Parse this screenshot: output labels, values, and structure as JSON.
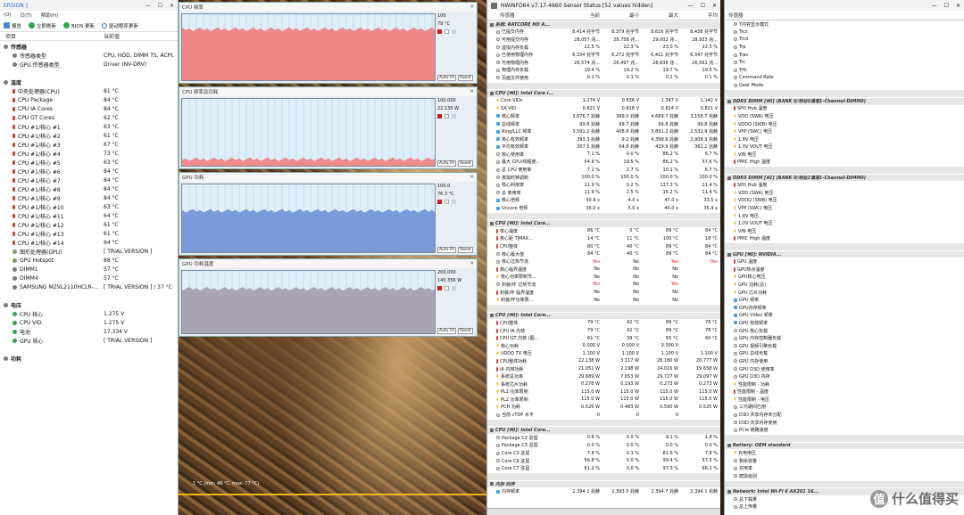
{
  "left": {
    "title": "ERSION ]",
    "menu": [
      "(O)",
      "日(T)",
      "帮助(H)"
    ],
    "toolbar": {
      "report": "报告",
      "refresh": "立即刷新",
      "bios": "BIOS 更新",
      "driver": "驱动程序更新"
    },
    "col_item": "项目",
    "col_value": "当前值",
    "rows": [
      {
        "g": true,
        "label": "传感器",
        "value": ""
      },
      {
        "i": 1,
        "icon": "dot",
        "label": "传感器类型",
        "value": "CPU, HDD, DIMM TS, ACPI, SNB"
      },
      {
        "i": 1,
        "icon": "dot",
        "label": "GPU 传感器类型",
        "value": "Driver (NV-DRV)"
      },
      {
        "g": false,
        "label": "",
        "value": ""
      },
      {
        "g": true,
        "label": "温度",
        "value": ""
      },
      {
        "i": 1,
        "icon": "temp",
        "label": "中央处理器(CPU)",
        "value": "81 °C"
      },
      {
        "i": 1,
        "icon": "temp",
        "label": "CPU Package",
        "value": "84 °C"
      },
      {
        "i": 1,
        "icon": "temp",
        "label": "CPU IA Cores",
        "value": "84 °C"
      },
      {
        "i": 1,
        "icon": "temp",
        "label": "CPU GT Cores",
        "value": "62 °C"
      },
      {
        "i": 1,
        "icon": "temp",
        "label": "CPU #1/核心 #1",
        "value": "63 °C"
      },
      {
        "i": 1,
        "icon": "temp",
        "label": "CPU #1/核心 #2",
        "value": "61 °C"
      },
      {
        "i": 1,
        "icon": "temp",
        "label": "CPU #1/核心 #3",
        "value": "67 °C"
      },
      {
        "i": 1,
        "icon": "temp",
        "label": "CPU #1/核心 #4",
        "value": "73 °C"
      },
      {
        "i": 1,
        "icon": "temp",
        "label": "CPU #1/核心 #5",
        "value": "63 °C"
      },
      {
        "i": 1,
        "icon": "temp",
        "label": "CPU #1/核心 #6",
        "value": "84 °C"
      },
      {
        "i": 1,
        "icon": "temp",
        "label": "CPU #1/核心 #7",
        "value": "84 °C"
      },
      {
        "i": 1,
        "icon": "temp",
        "label": "CPU #1/核心 #8",
        "value": "84 °C"
      },
      {
        "i": 1,
        "icon": "temp",
        "label": "CPU #1/核心 #9",
        "value": "84 °C"
      },
      {
        "i": 1,
        "icon": "temp",
        "label": "CPU #1/核心 #10",
        "value": "63 °C"
      },
      {
        "i": 1,
        "icon": "temp",
        "label": "CPU #1/核心 #11",
        "value": "64 °C"
      },
      {
        "i": 1,
        "icon": "temp",
        "label": "CPU #1/核心 #12",
        "value": "61 °C"
      },
      {
        "i": 1,
        "icon": "temp",
        "label": "CPU #1/核心 #13",
        "value": "61 °C"
      },
      {
        "i": 1,
        "icon": "temp",
        "label": "CPU #1/核心 #14",
        "value": "64 °C"
      },
      {
        "i": 1,
        "icon": "green",
        "label": "图形处理器(GPU)",
        "value": "[ TRIAL VERSION ]"
      },
      {
        "i": 1,
        "icon": "green",
        "label": "GPU Hotspot",
        "value": "88 °C"
      },
      {
        "i": 1,
        "icon": "dot",
        "label": "DIMM1",
        "value": "57 °C"
      },
      {
        "i": 1,
        "icon": "dot",
        "label": "DIMM4",
        "value": "57 °C"
      },
      {
        "i": 1,
        "icon": "dot",
        "label": "SAMSUNG MZVL2110HCLR-...",
        "value": "[ TRIAL VERSION ] / 37 °C"
      },
      {
        "g": false,
        "label": "",
        "value": ""
      },
      {
        "g": true,
        "label": "电压",
        "value": ""
      },
      {
        "i": 1,
        "icon": "volt",
        "label": "CPU 核心",
        "value": "1.275 V"
      },
      {
        "i": 1,
        "icon": "volt",
        "label": "CPU VID",
        "value": "1.275 V"
      },
      {
        "i": 1,
        "icon": "volt",
        "label": "电池",
        "value": "17.334 V"
      },
      {
        "i": 1,
        "icon": "volt",
        "label": "GPU 核心",
        "value": "[ TRIAL VERSION ]"
      },
      {
        "g": false,
        "label": "",
        "value": ""
      },
      {
        "g": true,
        "label": "功耗",
        "value": ""
      }
    ]
  },
  "graphs": [
    {
      "title": "CPU 频率",
      "top": "100",
      "mid": "79 °C",
      "color": "#f08a8a",
      "fill": 0.78,
      "btn1": "Auto Fit",
      "btn2": "Reset"
    },
    {
      "title": "CPU 频率及功耗",
      "top": "100.000",
      "mid": "22.130 W",
      "color": "#f08a8a",
      "fill": 0.12,
      "btn1": "Auto Fit",
      "btn2": "Reset"
    },
    {
      "title": "GPU 功耗",
      "top": "100.0",
      "mid": "76.3 °C",
      "color": "#7a9ad8",
      "fill": 0.62,
      "btn1": "Auto Fit",
      "btn2": "Reset"
    },
    {
      "title": "GPU 功耗温度",
      "top": "200.000",
      "mid": "140.356 W",
      "color": "#a9a4b6",
      "fill": 0.72,
      "btn1": "Auto Fit",
      "btn2": "Reset"
    }
  ],
  "osd": "1 °C (min: 46 °C, max: 77 °C)",
  "hw1": {
    "title": "HWiNFO64 v7.17-4660 Sensor Status [52 values hidden]",
    "cols": [
      "传感器",
      "当前",
      "最小",
      "最大",
      "平均"
    ],
    "rows": [
      {
        "s": true,
        "n": "系统: RATCORE HO A..."
      },
      {
        "n": "已提交内存",
        "v": [
          "8,414 兆字节",
          "8,379 兆字节",
          "8,616 兆字节",
          "8,438 兆字节"
        ]
      },
      {
        "n": "可用提交内存",
        "v": [
          "28,057 兆...",
          "28,758 兆...",
          "29,002 兆...",
          "28,933 兆..."
        ]
      },
      {
        "n": "虚拟内存负载",
        "v": [
          "22.5 %",
          "22.3 %",
          "23.0 %",
          "22.5 %"
        ]
      },
      {
        "n": "已使用物理内存",
        "v": [
          "6,334 兆字节",
          "6,272 兆字节",
          "6,411 兆字节",
          "6,347 兆字节"
        ]
      },
      {
        "n": "可用物理内存",
        "v": [
          "26,574 兆...",
          "26,497 兆...",
          "26,636 兆...",
          "26,561 兆..."
        ]
      },
      {
        "n": "物理内存负载",
        "v": [
          "19.4 %",
          "19.2 %",
          "19.7 %",
          "19.5 %"
        ]
      },
      {
        "n": "页面文件使用",
        "v": [
          "0.1 %",
          "0.1 %",
          "0.1 %",
          "0.1 %"
        ]
      },
      {
        "s": true,
        "n": ""
      },
      {
        "s": true,
        "n": "CPU [#0]: Intel Core i..."
      },
      {
        "n": "Core VIDs",
        "v": [
          "1.274 V",
          "0.636 V",
          "1.347 V",
          "1.142 V"
        ]
      },
      {
        "n": "SA VID",
        "v": [
          "0.821 V",
          "0.818 V",
          "0.824 V",
          "0.821 V"
        ]
      },
      {
        "n": "核心频率",
        "v": [
          "3,676.7 兆赫",
          "399.0 兆赫",
          "4,689.7 兆赫",
          "3,158.7 兆赫"
        ]
      },
      {
        "n": "总线频率",
        "v": [
          "99.8 兆赫",
          "99.7 兆赫",
          "99.8 兆赫",
          "99.8 兆赫"
        ]
      },
      {
        "n": "Ring/LLC 频率",
        "v": [
          "3,591.2 兆赫",
          "408.8 兆赫",
          "3,891.2 兆赫",
          "2,532.9 兆赫"
        ]
      },
      {
        "n": "核心有效频率",
        "v": [
          "393.3 兆赫",
          "9.2 兆赫",
          "4,398.9 兆赫",
          "2,908.3 兆赫"
        ]
      },
      {
        "n": "平均有效频率",
        "v": [
          "307.5 兆赫",
          "64.8 兆赫",
          "429.9 兆赫",
          "362.1 兆赫"
        ]
      },
      {
        "n": "核心使用率",
        "v": [
          "7.1 %",
          "0.0 %",
          "86.2 %",
          "6.7 %"
        ]
      },
      {
        "n": "最大 CPU/线程使...",
        "v": [
          "54.8 %",
          "19.5 %",
          "86.2 %",
          "57.6 %"
        ]
      },
      {
        "n": "总 CPU 使用率",
        "v": [
          "7.1 %",
          "2.7 %",
          "10.1 %",
          "6.7 %"
        ]
      },
      {
        "n": "按需时钟调制",
        "v": [
          "100.0 %",
          "100.0 %",
          "100.0 %",
          "100.0 %"
        ]
      },
      {
        "n": "核心利用率",
        "v": [
          "11.9 %",
          "0.2 %",
          "137.3 %",
          "11.4 %"
        ]
      },
      {
        "n": "总 使用率",
        "v": [
          "11.9 %",
          "2.5 %",
          "15.2 %",
          "11.4 %"
        ]
      },
      {
        "n": "核心倍频",
        "v": [
          "30.9 x",
          "4.0 x",
          "47.0 x",
          "33.5 x"
        ]
      },
      {
        "n": "Uncore 倍频",
        "v": [
          "36.0 x",
          "5.0 x",
          "40.0 x",
          "35.4 x"
        ]
      },
      {
        "s": true,
        "n": ""
      },
      {
        "s": true,
        "n": "CPU [#0]: Intel Core..."
      },
      {
        "n": "核心温度",
        "v": [
          "86 °C",
          "0 °C",
          "89 °C",
          "84 °C"
        ]
      },
      {
        "n": "核心距 TjMAX...",
        "v": [
          "14 °C",
          "11 °C",
          "100 °C",
          "16 °C"
        ]
      },
      {
        "n": "CPU整体",
        "v": [
          "80 °C",
          "40 °C",
          "89 °C",
          "84 °C"
        ]
      },
      {
        "n": "核心最大值",
        "v": [
          "84 °C",
          "40 °C",
          "89 °C",
          "84 °C"
        ]
      },
      {
        "n": "核心过热节流",
        "v": [
          "Yes",
          "No",
          "Yes",
          "Yes"
        ],
        "red": true
      },
      {
        "n": "核心临界温度",
        "v": [
          "No",
          "No",
          "No",
          ""
        ]
      },
      {
        "n": "核心功率限制节...",
        "v": [
          "No",
          "No",
          "No",
          ""
        ]
      },
      {
        "n": "封装/环 过热节流",
        "v": [
          "Yes",
          "No",
          "Yes",
          ""
        ],
        "red": true
      },
      {
        "n": "封装/环 临界温度",
        "v": [
          "No",
          "No",
          "No",
          ""
        ]
      },
      {
        "n": "封装/环功率限...",
        "v": [
          "No",
          "No",
          "No",
          ""
        ]
      },
      {
        "s": true,
        "n": ""
      },
      {
        "s": true,
        "n": "CPU [#0]: Intel Core..."
      },
      {
        "n": "CPU整体",
        "v": [
          "79 °C",
          "42 °C",
          "89 °C",
          "78 °C"
        ]
      },
      {
        "n": "CPU IA 内核",
        "v": [
          "79 °C",
          "42 °C",
          "89 °C",
          "78 °C"
        ]
      },
      {
        "n": "CPU GT 内核 (图...",
        "v": [
          "61 °C",
          "39 °C",
          "65 °C",
          "60 °C"
        ]
      },
      {
        "n": "核心功耗",
        "v": [
          "0.000 V",
          "0.000 V",
          "0.000 V",
          ""
        ]
      },
      {
        "n": "VDDQ TX 电压",
        "v": [
          "1.100 V",
          "1.100 V",
          "1.100 V",
          "1.100 V"
        ]
      },
      {
        "n": "CPU整体功耗",
        "v": [
          "22.138 W",
          "3.117 W",
          "28.180 W",
          "20.777 W"
        ]
      },
      {
        "n": "IA 内核功耗",
        "v": [
          "21.051 W",
          "2.198 W",
          "24.016 W",
          "19.658 W"
        ]
      },
      {
        "n": "系统总功率",
        "v": [
          "29.689 W",
          "7.653 W",
          "29.727 W",
          "29.097 W"
        ]
      },
      {
        "n": "系统芯片功耗",
        "v": [
          "0.278 W",
          "0.193 W",
          "0.273 W",
          "0.273 W"
        ]
      },
      {
        "n": "PL1 功率限制",
        "v": [
          "115.0 W",
          "115.0 W",
          "115.0 W",
          "115.0 W"
        ]
      },
      {
        "n": "PL2 功率限制",
        "v": [
          "115.0 W",
          "115.0 W",
          "115.0 W",
          "115.0 W"
        ]
      },
      {
        "n": "PCH 功耗",
        "v": [
          "0.526 W",
          "0.483 W",
          "0.590 W",
          "0.525 W"
        ]
      },
      {
        "n": "当前 cTDP 水平",
        "v": [
          "0",
          "0",
          "0",
          ""
        ]
      },
      {
        "s": true,
        "n": ""
      },
      {
        "s": true,
        "n": "CPU [#0]: Intel Core..."
      },
      {
        "n": "Package C2 驻留",
        "v": [
          "0.6 %",
          "0.0 %",
          "9.1 %",
          "1.8 %"
        ]
      },
      {
        "n": "Package C3 驻留",
        "v": [
          "0.0 %",
          "0.0 %",
          "0.0 %",
          "0.0 %"
        ]
      },
      {
        "n": "Core C0 驻留",
        "v": [
          "7.8 %",
          "0.3 %",
          "81.6 %",
          "7.8 %"
        ]
      },
      {
        "n": "Core C6 驻留",
        "v": [
          "56.8 %",
          "0.0 %",
          "99.4 %",
          "57.5 %"
        ]
      },
      {
        "n": "Core C7 驻留",
        "v": [
          "61.2 %",
          "0.0 %",
          "97.3 %",
          "66.2 %"
        ]
      },
      {
        "s": true,
        "n": ""
      },
      {
        "s": true,
        "n": "内存 时序"
      },
      {
        "n": "内存频率",
        "v": [
          "2,394.1 兆赫",
          "2,393.5 兆赫",
          "2,394.7 兆赫",
          "2,394.1 兆赫"
        ]
      }
    ]
  },
  "hw2": {
    "col": "传感器",
    "rows": [
      {
        "n": "T内容显示模式"
      },
      {
        "n": "Trcs"
      },
      {
        "n": "Trcd"
      },
      {
        "n": "Trp"
      },
      {
        "n": "Tras"
      },
      {
        "n": "Trc"
      },
      {
        "n": "Trfc"
      },
      {
        "n": "Command Rate"
      },
      {
        "n": "Gear Mode"
      },
      {
        "s": true,
        "n": ""
      },
      {
        "s": true,
        "n": "DDR5 DIMM [#0] (BANK 0/地址0通道1-Channel-DIMM0)"
      },
      {
        "n": "SPD Hub 温度"
      },
      {
        "n": "VDD (SWA) 电压"
      },
      {
        "n": "VDDQ (SWB) 电压"
      },
      {
        "n": "VPP (SWC) 电压"
      },
      {
        "n": "1.8V 电压"
      },
      {
        "n": "1.0V VOUT 电压"
      },
      {
        "n": "VIN 电压"
      },
      {
        "n": "PMIC High 温度"
      },
      {
        "s": true,
        "n": ""
      },
      {
        "s": true,
        "n": "DDR5 DIMM [#2] (BANK 0/地址2通道1-Channel-DIMM0)"
      },
      {
        "n": "SPD Hub 温度"
      },
      {
        "n": "VDD (SWA) 电压"
      },
      {
        "n": "VDDQ (SWB) 电压"
      },
      {
        "n": "VPP (SWC) 电压"
      },
      {
        "n": "1.8V 电压"
      },
      {
        "n": "1.0V VOUT 电压"
      },
      {
        "n": "VIN 电压"
      },
      {
        "n": "PMIC High 温度"
      },
      {
        "s": true,
        "n": ""
      },
      {
        "s": true,
        "n": "GPU [#0]: NVIDIA..."
      },
      {
        "n": "GPU 温度"
      },
      {
        "n": "GPU热点温度"
      },
      {
        "n": "GPU核心电压"
      },
      {
        "n": "GPU 功耗(总)"
      },
      {
        "n": "GPU 芯片功耗"
      },
      {
        "n": "GPU 频率"
      },
      {
        "n": "GPU内存频率"
      },
      {
        "n": "GPU Video 频率"
      },
      {
        "n": "GPU 有效频率"
      },
      {
        "n": "GPU 核心负载"
      },
      {
        "n": "GPU 内存控制器负载"
      },
      {
        "n": "GPU 视频引擎负载"
      },
      {
        "n": "GPU 总线负载"
      },
      {
        "n": "GPU 内存使用"
      },
      {
        "n": "GPU D3D 使用率"
      },
      {
        "n": "GPU D3D 内存"
      },
      {
        "n": "性能限制 - 功耗"
      },
      {
        "n": "性能限制 - 温度"
      },
      {
        "n": "性能限制 - 电压"
      },
      {
        "n": "三元期间已用"
      },
      {
        "n": "D3D 共享内存未分配"
      },
      {
        "n": "D3D 共享内存使用"
      },
      {
        "n": "PCIe 链路速度"
      },
      {
        "s": true,
        "n": ""
      },
      {
        "s": true,
        "n": "Battery: OEM standard"
      },
      {
        "n": "充电电压"
      },
      {
        "n": "剩余容量"
      },
      {
        "n": "充电率"
      },
      {
        "n": "磨损级别"
      },
      {
        "s": true,
        "n": ""
      },
      {
        "s": true,
        "n": "Network: Intel Wi-Fi 6 AX201 16..."
      },
      {
        "n": "总下载量"
      },
      {
        "n": "总上传量"
      }
    ]
  },
  "watermark": "什么值得买",
  "colors": {
    "accent": "#2a6ad6",
    "red_graph": "#f08a8a",
    "blue_graph": "#7a9ad8",
    "gray_graph": "#a9a4b6"
  }
}
